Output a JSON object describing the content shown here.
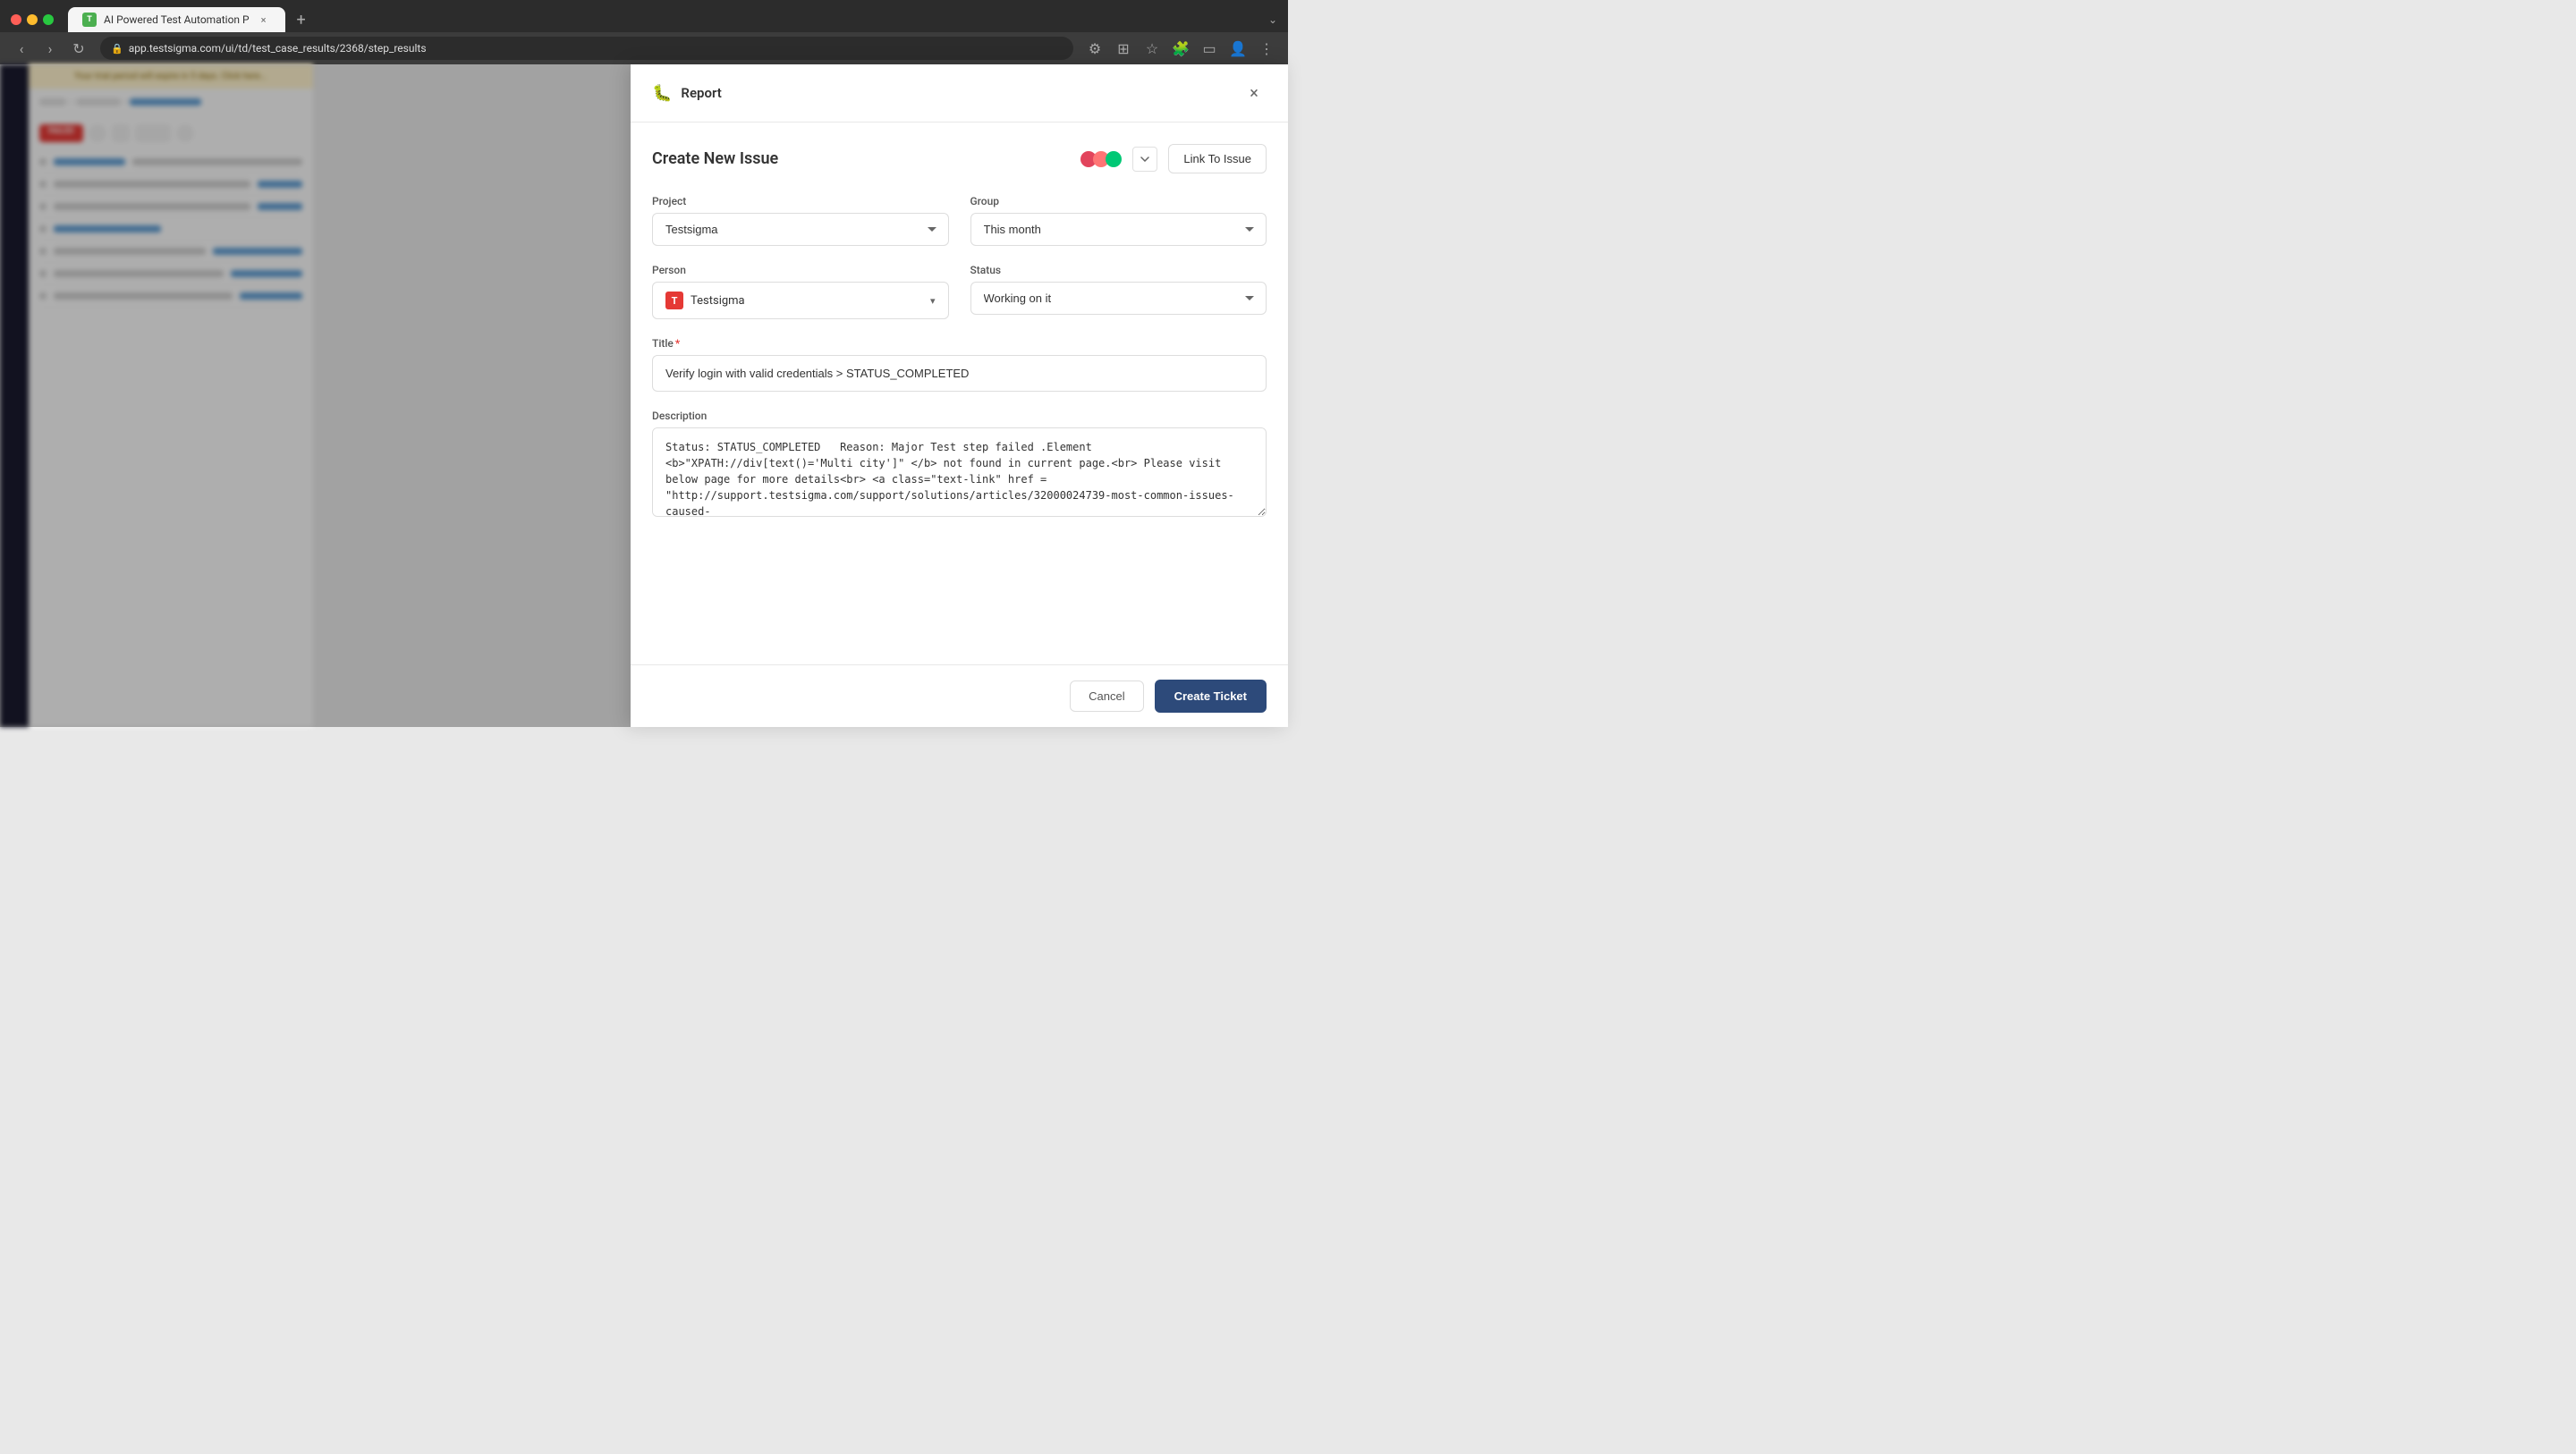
{
  "browser": {
    "tab_label": "AI Powered Test Automation P",
    "url": "app.testsigma.com/ui/td/test_case_results/2368/step_results",
    "new_tab_icon": "+"
  },
  "dialog": {
    "header_icon": "🐛",
    "title": "Report",
    "close_label": "×",
    "form_title": "Create New Issue",
    "link_to_issue_label": "Link To Issue",
    "fields": {
      "project_label": "Project",
      "project_value": "Testsigma",
      "group_label": "Group",
      "group_value": "This month",
      "person_label": "Person",
      "person_value": "Testsigma",
      "person_avatar": "T",
      "status_label": "Status",
      "status_value": "Working on it",
      "title_label": "Title",
      "title_required": "*",
      "title_value": "Verify login with valid credentials > STATUS_COMPLETED",
      "description_label": "Description",
      "description_value": "Status: STATUS_COMPLETED   Reason: Major Test step failed .Element <b>\"XPATH://div[text()='Multi city']\" </b> not found in current page.<br> Please visit below page for more details<br> <a class=\"text-link\" href = \"http://support.testsigma.com/support/solutions/articles/32000024739-most-common-issues-caused-"
    },
    "footer": {
      "cancel_label": "Cancel",
      "create_ticket_label": "Create Ticket"
    }
  },
  "background": {
    "banner_text": "Your trial period will expire in 5 days. Click here...",
    "badge_failed": "FAILED"
  }
}
